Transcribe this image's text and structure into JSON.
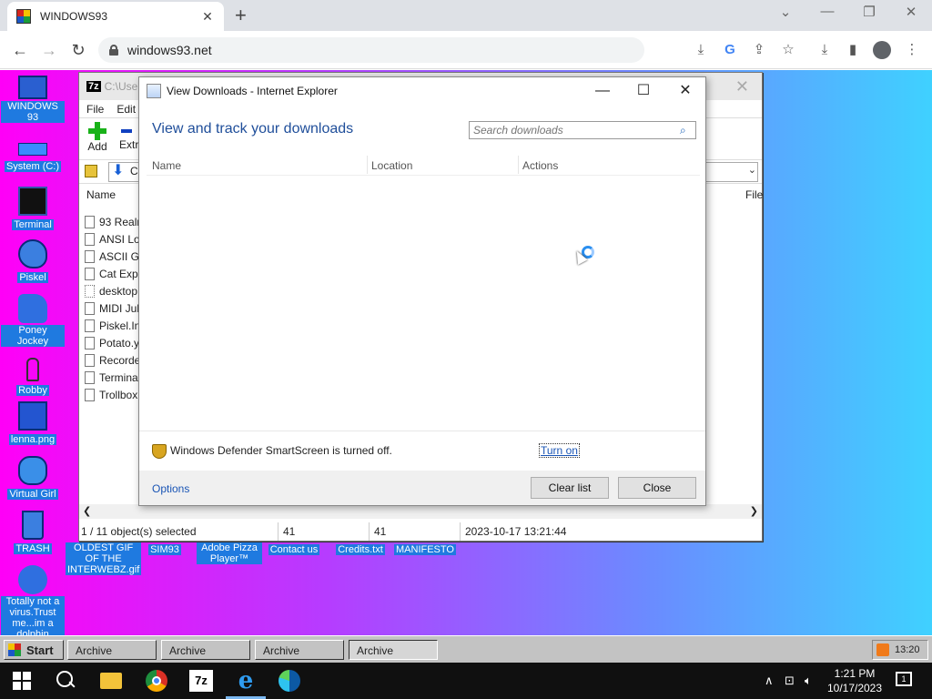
{
  "browser": {
    "tab_title": "WINDOWS93",
    "tab_close": "✕",
    "new_tab": "+",
    "url": "windows93.net",
    "controls": {
      "chevron": "⌄",
      "minimize": "—",
      "restore": "❐",
      "close": "✕"
    },
    "nav": {
      "back": "←",
      "forward": "→",
      "reload": "↻"
    },
    "bar_icons": {
      "install": "⤓",
      "google": "G",
      "share": "⇪",
      "star": "☆",
      "downloads": "⤓",
      "sidepanel": "▮",
      "menu": "⋮"
    }
  },
  "desktop": {
    "icons_left": [
      {
        "label": "WINDOWS 93"
      },
      {
        "label": "System (C:)"
      },
      {
        "label": "Terminal"
      },
      {
        "label": "Piskel"
      },
      {
        "label": "Poney Jockey"
      },
      {
        "label": "Robby"
      },
      {
        "label": "lenna.png"
      },
      {
        "label": "Virtual Girl"
      },
      {
        "label": "TRASH"
      },
      {
        "label": "Totally not a virus.Trust me...im a dolphin"
      }
    ],
    "icons_bottom": [
      {
        "label": "OLDEST GIF OF THE INTERWEBZ.gif"
      },
      {
        "label": "SIM93"
      },
      {
        "label": "Adobe Pizza Player™"
      },
      {
        "label": "Contact us"
      },
      {
        "label": "Credits.txt"
      },
      {
        "label": "MANIFESTO"
      }
    ]
  },
  "archive_window": {
    "title_logo": "7z",
    "title": "C:\\Use",
    "close": "✕",
    "menu": [
      "File",
      "Edit"
    ],
    "toolbar": {
      "add": "Add",
      "extract": "Extr"
    },
    "path_partial": "C",
    "header_name": "Name",
    "header_file": "File",
    "files": [
      "93 Realm",
      "ANSI Lo",
      "ASCII Ga",
      "Cat Exp",
      "desktop",
      "MIDI Jul",
      "Piskel.In",
      "Potato.y",
      "Recorde",
      "Termina",
      "Trollbox"
    ],
    "status": {
      "selected": "1 / 11 object(s) selected",
      "size": "41",
      "packed": "41",
      "modified": "2023-10-17 13:21:44"
    },
    "scroll_left": "❮",
    "scroll_right": "❯"
  },
  "downloads_dialog": {
    "title": "View Downloads - Internet Explorer",
    "controls": {
      "minimize": "—",
      "maximize": "☐",
      "close": "✕"
    },
    "heading": "View and track your downloads",
    "search_placeholder": "Search downloads",
    "search_icon": "⌕",
    "columns": [
      "Name",
      "Location",
      "Actions"
    ],
    "smartscreen_text": "Windows Defender SmartScreen is turned off.",
    "turn_on": "Turn on",
    "options": "Options",
    "clear_list": "Clear list",
    "close": "Close"
  },
  "w93_taskbar": {
    "start": "Start",
    "tasks": [
      "Archive",
      "Archive",
      "Archive",
      "Archive"
    ],
    "tray_time": "13:20"
  },
  "win_taskbar": {
    "sevenz": "7z",
    "ie": "e",
    "tray": {
      "chevron": "∧",
      "network": "⊡",
      "volume": "🔈︎"
    },
    "time": "1:21 PM",
    "date": "10/17/2023",
    "notifications": "1"
  },
  "colors": {
    "desktop_gradient_start": "#ff00f7",
    "desktop_gradient_end": "#3fd1ff",
    "icon_label_bg": "#1f7ae0",
    "link_blue": "#1a55b5",
    "heading_blue": "#1f4e9a"
  }
}
